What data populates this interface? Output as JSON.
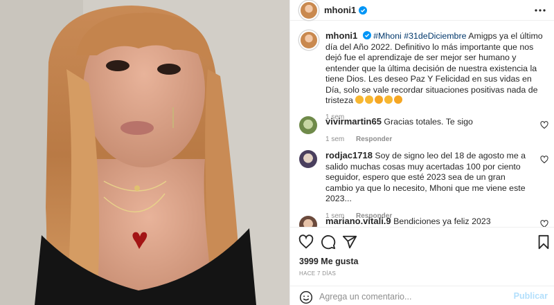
{
  "post": {
    "username": "mhoni1",
    "verified": true
  },
  "caption": {
    "username": "mhoni1",
    "hashtag1": "#Mhoni",
    "hashtag2": "#31deDiciembre",
    "text": "Amigps ya el último día del Año 2022. Definitivo lo más importante que nos dejó fue el aprendizaje de ser mejor ser humano y entender que la última decisión de nuestra existencia la tiene Dios. Les deseo Paz Y Felicidad en sus vidas en Día, solo se vale recordar situaciones positivas nada de tristeza",
    "time": "1 sem"
  },
  "comments": [
    {
      "username": "vivirmartin65",
      "text": "Gracias totales. Te sigo",
      "time": "1 sem",
      "reply": "Responder",
      "avatar_color": "#9bb07a"
    },
    {
      "username": "rodjac1718",
      "text": "Soy de signo leo del 18 de agosto me a salido muchas cosas muy acertadas 100 por ciento seguidor, espero que esté 2023 sea de un gran cambio ya que lo necesito, Mhoni que me viene este 2023...",
      "time": "1 sem",
      "reply": "Responder",
      "avatar_color": "#7c6f8a"
    },
    {
      "username": "mariano.vitali.9",
      "text": "Bendiciones ya feliz 2023",
      "avatar_color": "#8a6b5c"
    }
  ],
  "stats": {
    "likes": "3999 Me gusta",
    "ago": "HACE 7 DÍAS"
  },
  "add_comment": {
    "placeholder": "Agrega un comentario...",
    "post_label": "Publicar"
  },
  "icons": {
    "verified": "verified-badge-icon",
    "more": "more-options-icon",
    "like": "heart-icon",
    "comment": "comment-icon",
    "share": "paper-plane-icon",
    "save": "bookmark-icon",
    "emoji": "emoji-smiley-icon"
  },
  "colors": {
    "accent": "#0095f6",
    "link": "#00376b",
    "post_button_disabled": "#b2dffc"
  }
}
